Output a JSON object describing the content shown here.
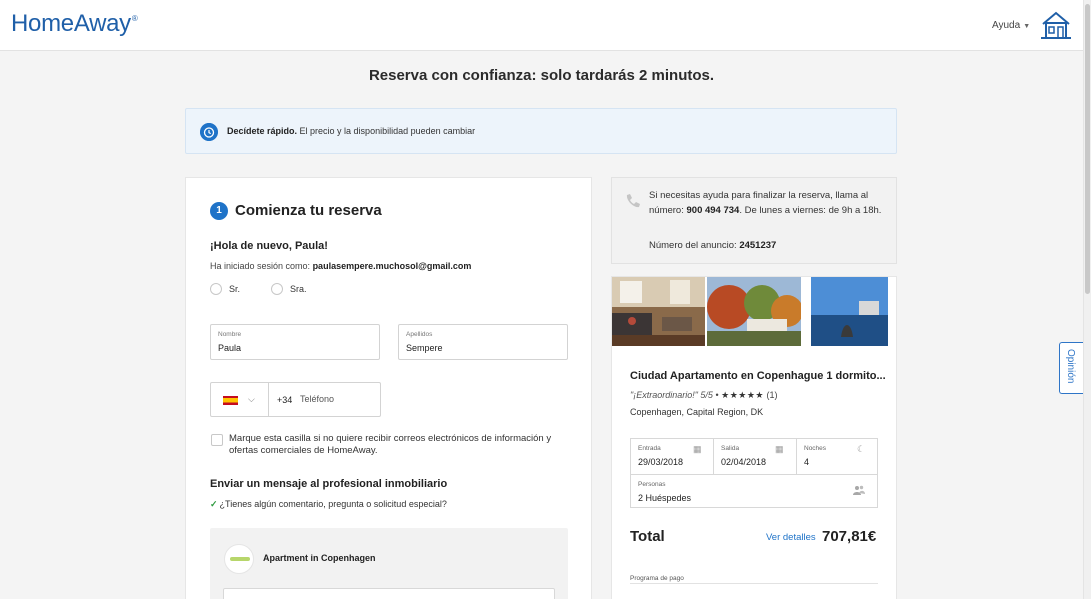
{
  "header": {
    "logo": "HomeAway",
    "logo_mark": "®",
    "help_label": "Ayuda"
  },
  "feedback_tab": "Opinión",
  "page": {
    "title": "Reserva con confianza: solo tardarás 2 minutos."
  },
  "alert": {
    "bold": "Decídete rápido.",
    "text": " El precio y la disponibilidad pueden cambiar"
  },
  "booking": {
    "step_number": "1",
    "step_title": "Comienza tu reserva",
    "greeting": "¡Hola de nuevo, Paula!",
    "session_prefix": "Ha iniciado sesión como: ",
    "session_email": "paulasempere.muchosol@gmail.com",
    "title_options": [
      "Sr.",
      "Sra."
    ],
    "first_name": {
      "label": "Nombre",
      "value": "Paula"
    },
    "last_name": {
      "label": "Apellidos",
      "value": "Sempere"
    },
    "phone": {
      "prefix": "+34",
      "placeholder": "Teléfono"
    },
    "optout_label": "Marque esta casilla si no quiere recibir correos electrónicos de información y ofertas comerciales de HomeAway.",
    "message_title": "Enviar un mensaje al profesional inmobiliario",
    "message_prompt": "¿Tienes algún comentario, pregunta o solicitud especial?",
    "owner_name": "Apartment in Copenhagen"
  },
  "help_box": {
    "text_before": "Si necesitas ayuda para finalizar la reserva, llama al número: ",
    "phone": "900 494 734",
    "text_after": ". De lunes a viernes: de 9h a 18h.",
    "ad_label": "Número del anuncio: ",
    "ad_number": "2451237"
  },
  "property": {
    "title": "Ciudad Apartamento en Copenhague 1 dormito...",
    "review_quote": "\"¡Extraordinario!\" 5/5",
    "bullet": "•",
    "stars": "★★★★★",
    "review_count": "(1)",
    "location": "Copenhagen, Capital Region, DK"
  },
  "stay": {
    "checkin_label": "Entrada",
    "checkin": "29/03/2018",
    "checkout_label": "Salida",
    "checkout": "02/04/2018",
    "nights_label": "Noches",
    "nights": "4",
    "guests_label": "Personas",
    "guests": "2 Huéspedes"
  },
  "total": {
    "label": "Total",
    "details_link": "Ver detalles",
    "value": "707,81€",
    "payment_plan_label": "Programa de pago"
  },
  "colors": {
    "brand_blue": "#1f5fa8",
    "accent_blue": "#1f73c8"
  }
}
